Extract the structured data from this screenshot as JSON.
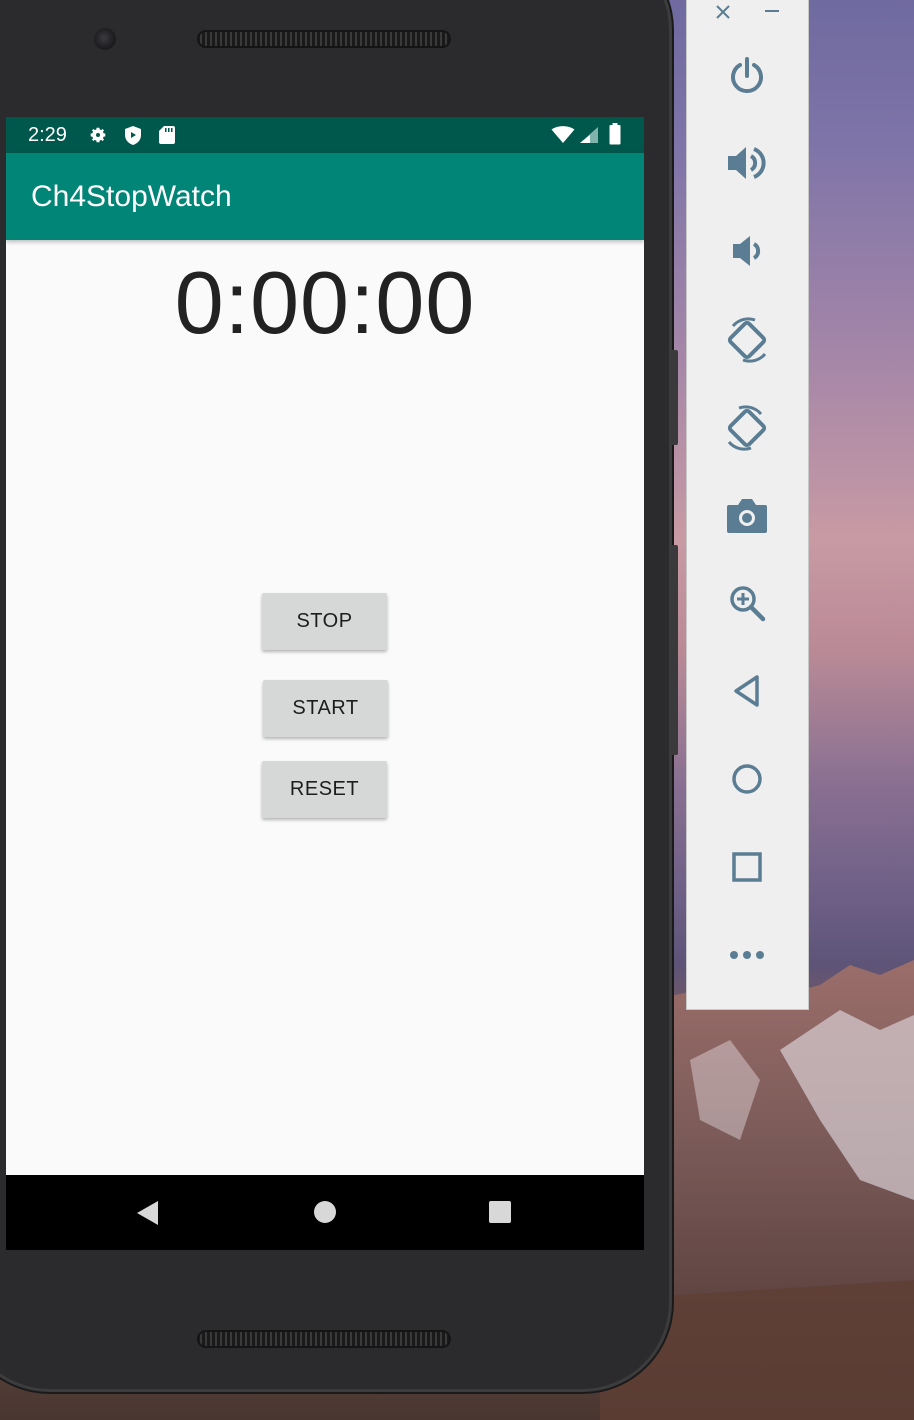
{
  "status_bar": {
    "time": "2:29",
    "icons": [
      "settings-icon",
      "shield-icon",
      "sd-card-icon",
      "wifi-icon",
      "signal-icon",
      "battery-icon"
    ]
  },
  "app": {
    "title": "Ch4StopWatch",
    "timer": "0:00:00",
    "buttons": {
      "stop": "STOP",
      "start": "START",
      "reset": "RESET"
    }
  },
  "nav_bar": {
    "icons": [
      "back-icon",
      "home-icon",
      "recents-icon"
    ]
  },
  "emulator_toolbar": {
    "window_controls": [
      "close-icon",
      "minimize-icon"
    ],
    "tools": [
      "power-icon",
      "volume-up-icon",
      "volume-down-icon",
      "rotate-left-icon",
      "rotate-right-icon",
      "camera-icon",
      "zoom-icon",
      "back-icon",
      "home-icon",
      "overview-icon",
      "more-icon"
    ]
  },
  "colors": {
    "status_bar": "#00574b",
    "app_bar": "#008577",
    "screen_bg": "#fafafa",
    "button_bg": "#d6d7d7",
    "toolbar_icon": "#5b7d93"
  }
}
